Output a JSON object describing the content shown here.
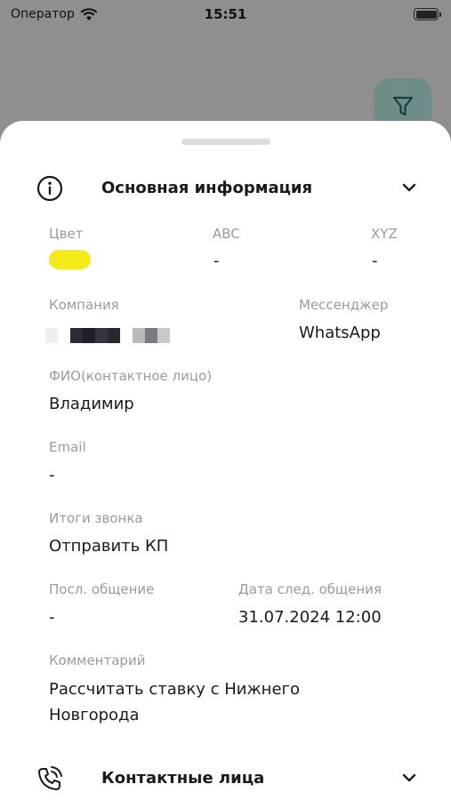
{
  "status_bar": {
    "carrier": "Оператор",
    "time": "15:51"
  },
  "colors": {
    "color_value": "#f4ea1a",
    "accent": "#6e8c88"
  },
  "main_section": {
    "title": "Основная информация",
    "color": {
      "label": "Цвет"
    },
    "abc": {
      "label": "ABC",
      "value": "-"
    },
    "xyz": {
      "label": "XYZ",
      "value": "-"
    },
    "company": {
      "label": "Компания"
    },
    "messenger": {
      "label": "Мессенджер",
      "value": "WhatsApp"
    },
    "contact_person": {
      "label": "ФИО(контактное лицо)",
      "value": "Владимир"
    },
    "email": {
      "label": "Email",
      "value": "-"
    },
    "call_result": {
      "label": "Итоги звонка",
      "value": "Отправить КП"
    },
    "last_contact": {
      "label": "Посл. общение",
      "value": "-"
    },
    "next_contact": {
      "label": "Дата след. общения",
      "value": "31.07.2024 12:00"
    },
    "comment": {
      "label": "Комментарий",
      "line1": "Рассчитать ставку с Нижнего",
      "line2": "Новгорода"
    }
  },
  "contacts_section": {
    "title": "Контактные лица"
  },
  "icons": [
    "wifi-icon",
    "battery-icon",
    "filter-icon",
    "info-icon",
    "chevron-down-icon",
    "phone-icon"
  ]
}
